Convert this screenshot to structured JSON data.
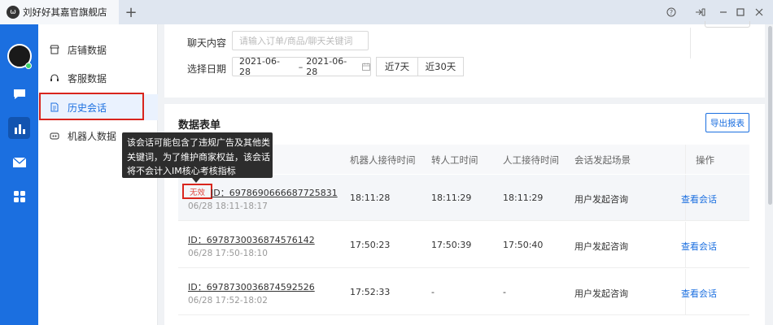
{
  "window": {
    "tab_title": "刘好好其嘉官旗舰店",
    "tab_logo": "ω",
    "new_tab": "+"
  },
  "subnav": {
    "items": [
      {
        "label": "店铺数据",
        "icon": "store-icon"
      },
      {
        "label": "客服数据",
        "icon": "headset-icon"
      },
      {
        "label": "历史会话",
        "icon": "document-icon"
      },
      {
        "label": "机器人数据",
        "icon": "robot-icon"
      }
    ],
    "active_index": 2
  },
  "filters": {
    "chat_label": "聊天内容",
    "chat_placeholder": "请输入订单/商品/聊天关键词",
    "date_label": "选择日期",
    "date_start": "2021-06-28",
    "date_sep": "–",
    "date_end": "2021-06-28",
    "quick_7": "近7天",
    "quick_30": "近30天"
  },
  "table": {
    "title": "数据表单",
    "export_label": "导出报表",
    "columns": [
      "机器人接待时间",
      "转人工时间",
      "人工接待时间",
      "会话发起场景",
      "操作"
    ],
    "rows": [
      {
        "id": "ID：6978690666687725831",
        "range": "06/28 18:11-18:17",
        "bot_time": "18:11:28",
        "transfer_time": "18:11:29",
        "human_time": "18:11:29",
        "scene": "用户发起咨询",
        "action": "查看会话",
        "badge": "无效"
      },
      {
        "id": "ID：6978730036874576142",
        "range": "06/28 17:50-18:10",
        "bot_time": "17:50:23",
        "transfer_time": "17:50:39",
        "human_time": "17:50:40",
        "scene": "用户发起咨询",
        "action": "查看会话"
      },
      {
        "id": "ID：6978730036874592526",
        "range": "06/28 17:52-18:02",
        "bot_time": "17:52:33",
        "transfer_time": "-",
        "human_time": "-",
        "scene": "用户发起咨询",
        "action": "查看会话"
      }
    ]
  },
  "tooltip": {
    "lines": [
      "该会话可能包含了违规广告及其他类",
      "关键词，为了维护商家权益，该会话",
      "将不会计入IM核心考核指标"
    ]
  },
  "colors": {
    "primary": "#1b6fe0",
    "highlight_red": "#d9251d"
  }
}
